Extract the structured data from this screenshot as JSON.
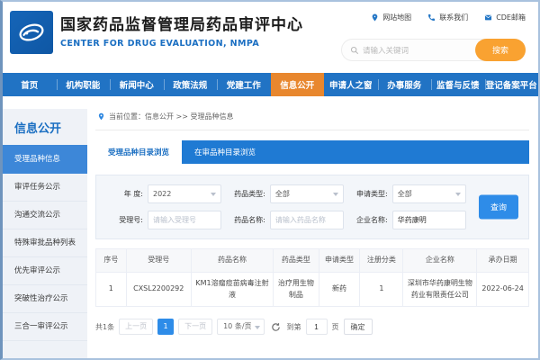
{
  "header": {
    "title": "国家药品监督管理局药品审评中心",
    "subtitle": "CENTER FOR DRUG EVALUATION, NMPA",
    "quick_links": [
      {
        "icon": "location-pin-icon",
        "label": "网站地图"
      },
      {
        "icon": "phone-icon",
        "label": "联系我们"
      },
      {
        "icon": "mail-icon",
        "label": "CDE邮箱"
      }
    ],
    "search": {
      "placeholder": "请输入关键词",
      "button_label": "搜索"
    }
  },
  "nav": {
    "items": [
      {
        "label": "首页"
      },
      {
        "label": "机构职能"
      },
      {
        "label": "新闻中心"
      },
      {
        "label": "政策法规"
      },
      {
        "label": "党建工作"
      },
      {
        "label": "信息公开",
        "active": true
      },
      {
        "label": "申请人之窗"
      },
      {
        "label": "办事服务"
      },
      {
        "label": "监督与反馈"
      },
      {
        "label": "登记备案平台"
      }
    ]
  },
  "sidebar": {
    "title": "信息公开",
    "items": [
      {
        "label": "受理品种信息",
        "active": true
      },
      {
        "label": "审评任务公示"
      },
      {
        "label": "沟通交流公示"
      },
      {
        "label": "特殊审批品种列表"
      },
      {
        "label": "优先审评公示"
      },
      {
        "label": "突破性治疗公示"
      },
      {
        "label": "三合一审评公示"
      }
    ]
  },
  "breadcrumb": "当前位置：信息公开 >> 受理品种信息",
  "tabs": [
    {
      "label": "受理品种目录浏览",
      "active": true
    },
    {
      "label": "在审品种目录浏览"
    }
  ],
  "filters": {
    "year": {
      "label": "年 度:",
      "value": "2022"
    },
    "drug_type": {
      "label": "药品类型:",
      "value": "全部"
    },
    "apply_type": {
      "label": "申请类型:",
      "value": "全部"
    },
    "acceptance_no": {
      "label": "受理号:",
      "placeholder": "请输入受理号"
    },
    "drug_name": {
      "label": "药品名称:",
      "placeholder": "请输入药品名称"
    },
    "company_name": {
      "label": "企业名称:",
      "value": "华药康明"
    },
    "query_button": "查询"
  },
  "table": {
    "headers": [
      "序号",
      "受理号",
      "药品名称",
      "药品类型",
      "申请类型",
      "注册分类",
      "企业名称",
      "承办日期"
    ],
    "rows": [
      [
        "1",
        "CXSL2200292",
        "KM1溶瘤痘苗病毒注射液",
        "治疗用生物制品",
        "新药",
        "1",
        "深圳市华药康明生物药业有限责任公司",
        "2022-06-24"
      ]
    ]
  },
  "pagination": {
    "total": "共1条",
    "prev": "上一页",
    "current": "1",
    "next": "下一页",
    "page_size": "10 条/页",
    "goto_label": "到第",
    "goto_value": "1",
    "goto_unit": "页",
    "confirm": "确定"
  },
  "colors": {
    "nav_blue": "#2173c4",
    "active_orange": "#e8872e",
    "brand_blue": "#1b6fc2",
    "sidebar_active_blue": "#3d87d8",
    "tabbar_blue": "#1f7ad3",
    "button_blue": "#2e8ce8",
    "search_orange": "#f9a231"
  }
}
